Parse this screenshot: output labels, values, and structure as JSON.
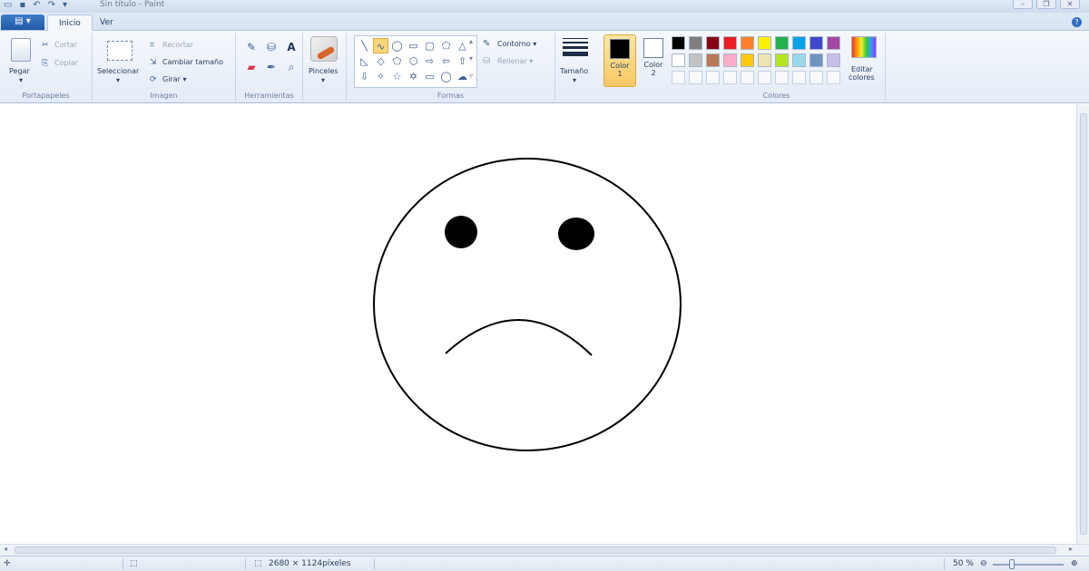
{
  "window": {
    "title": "Sin título - Paint",
    "file_menu_label": "▤ ▾",
    "qat_icons": [
      "save-icon",
      "undo-icon",
      "redo-icon",
      "customize-icon"
    ],
    "controls": [
      "minimize",
      "maximize",
      "close"
    ]
  },
  "tabs": [
    {
      "label": "Inicio",
      "active": true
    },
    {
      "label": "Ver",
      "active": false
    }
  ],
  "ribbon": {
    "clipboard": {
      "group": "Portapapeles",
      "paste": "Pegar",
      "cut": "Cortar",
      "copy": "Copiar"
    },
    "image": {
      "group": "Imagen",
      "select": "Seleccionar",
      "crop": "Recortar",
      "resize": "Cambiar tamaño",
      "rotate": "Girar ▾"
    },
    "tools": {
      "group": "Herramientas"
    },
    "brushes": {
      "label": "Pinceles"
    },
    "shapes": {
      "group": "Formas",
      "outline": "Contorno ▾",
      "fill": "Rellenar ▾"
    },
    "size": {
      "label": "Tamaño"
    },
    "color1": {
      "label": "Color",
      "num": "1",
      "value": "#000000"
    },
    "color2": {
      "label": "Color",
      "num": "2",
      "value": "#ffffff"
    },
    "colors": {
      "group": "Colores",
      "edit": "Editar",
      "edit2": "colores"
    },
    "palette": [
      "#000000",
      "#7f7f7f",
      "#880015",
      "#ed1c24",
      "#ff7f27",
      "#fff200",
      "#22b14c",
      "#00a2e8",
      "#3f48cc",
      "#a349a4",
      "#ffffff",
      "#c3c3c3",
      "#b97a57",
      "#ffaec9",
      "#ffc90e",
      "#efe4b0",
      "#b5e61d",
      "#99d9ea",
      "#7092be",
      "#c8bfe7"
    ]
  },
  "canvas": {
    "drawing": "sad-face",
    "stroke": "#000000"
  },
  "status": {
    "canvas_size": "2680 × 1124píxeles",
    "zoom": "50 %"
  }
}
